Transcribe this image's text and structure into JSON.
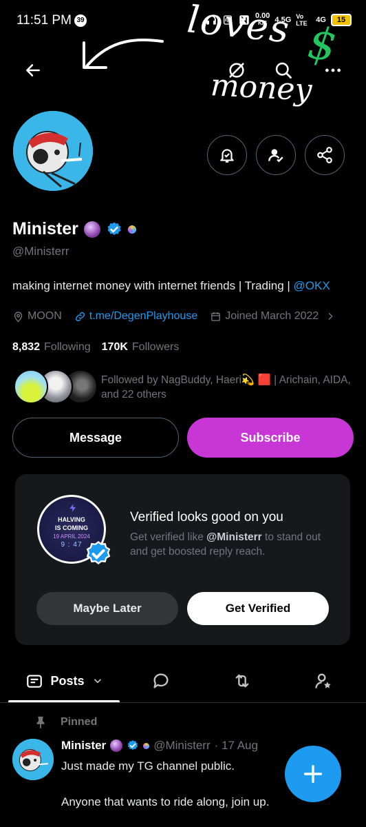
{
  "status_bar": {
    "time": "11:51 PM",
    "notification_count": "39",
    "net_speed": "0.00",
    "net_unit": "K/S",
    "net_type": "4.5G",
    "volte": "Vo LTE",
    "signal": "4G",
    "battery": "15"
  },
  "scribble": {
    "line1": "loves",
    "line2": "money",
    "symbol": "$"
  },
  "nav": {
    "icons": [
      "back-arrow-icon",
      "grok-icon",
      "search-icon",
      "more-icon"
    ]
  },
  "profile": {
    "name": "Minister",
    "handle": "@Ministerr",
    "bio_text": "making internet money with internet friends | Trading | ",
    "bio_mention": "@OKX",
    "location": "MOON",
    "link": "t.me/DegenPlayhouse",
    "joined": "Joined March 2022",
    "following_count": "8,832",
    "following_label": "Following",
    "followers_count": "170K",
    "followers_label": "Followers",
    "followed_by": "Followed by NagBuddy, Haeri💫 🟥 | Arichain, AIDA, and 22 others"
  },
  "actions": {
    "message": "Message",
    "subscribe": "Subscribe",
    "subscribe_color": "#c936d6"
  },
  "verify_card": {
    "image_line1": "HALVING",
    "image_line2": "IS COMING",
    "image_line3": "19 APRIL 2024",
    "image_line4": "9 : 47",
    "title": "Verified looks good on you",
    "desc_prefix": "Get verified like ",
    "desc_handle": "@Ministerr",
    "desc_suffix": " to stand out and get boosted reply reach.",
    "later_label": "Maybe Later",
    "verify_label": "Get Verified"
  },
  "tabs": {
    "posts_label": "Posts"
  },
  "pinned_post": {
    "pinned_label": "Pinned",
    "author": "Minister",
    "handle": "@Ministerr",
    "date": "· 17 Aug",
    "line1": "Just made my TG channel public.",
    "line2": "Anyone that wants to ride along, join up."
  },
  "colors": {
    "accent": "#1d9bf0",
    "background": "#000000",
    "muted": "#71767b"
  }
}
